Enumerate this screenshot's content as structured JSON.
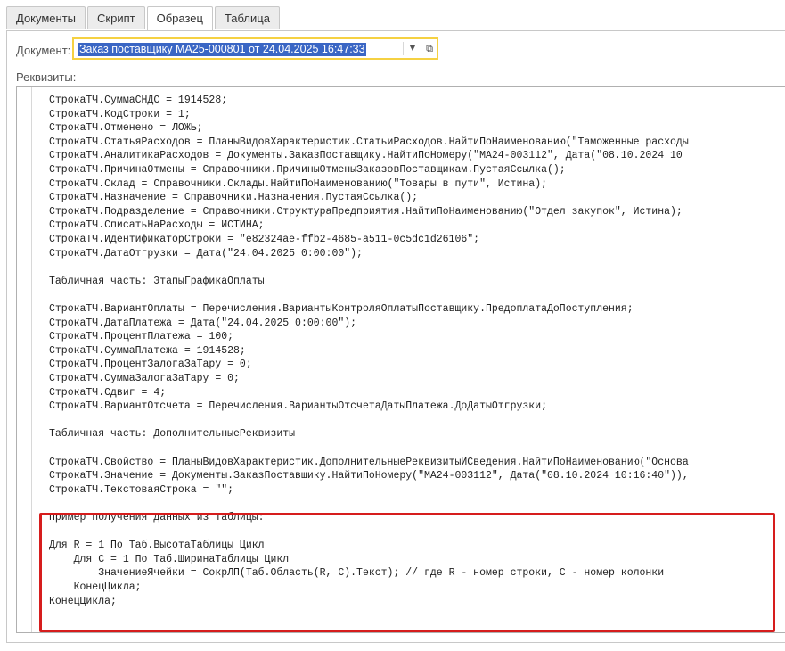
{
  "tabs": [
    {
      "label": "Документы",
      "active": false
    },
    {
      "label": "Скрипт",
      "active": false
    },
    {
      "label": "Образец",
      "active": true
    },
    {
      "label": "Таблица",
      "active": false
    }
  ],
  "document": {
    "label": "Документ:",
    "value": "Заказ поставщику МА25-000801 от 24.04.2025 16:47:33"
  },
  "requisites_label": "Реквизиты:",
  "code_lines": [
    "СтрокаТЧ.СуммаСНДС = 1914528;",
    "СтрокаТЧ.КодСтроки = 1;",
    "СтрокаТЧ.Отменено = ЛОЖЬ;",
    "СтрокаТЧ.СтатьяРасходов = ПланыВидовХарактеристик.СтатьиРасходов.НайтиПоНаименованию(\"Таможенные расходы",
    "СтрокаТЧ.АналитикаРасходов = Документы.ЗаказПоставщику.НайтиПоНомеру(\"МА24-003112\", Дата(\"08.10.2024 10",
    "СтрокаТЧ.ПричинаОтмены = Справочники.ПричиныОтменыЗаказовПоставщикам.ПустаяСсылка();",
    "СтрокаТЧ.Склад = Справочники.Склады.НайтиПоНаименованию(\"Товары в пути\", Истина);",
    "СтрокаТЧ.Назначение = Справочники.Назначения.ПустаяСсылка();",
    "СтрокаТЧ.Подразделение = Справочники.СтруктураПредприятия.НайтиПоНаименованию(\"Отдел закупок\", Истина);",
    "СтрокаТЧ.СписатьНаРасходы = ИСТИНА;",
    "СтрокаТЧ.ИдентификаторСтроки = \"e82324ae-ffb2-4685-a511-0c5dc1d26106\";",
    "СтрокаТЧ.ДатаОтгрузки = Дата(\"24.04.2025 0:00:00\");",
    "",
    "Табличная часть: ЭтапыГрафикаОплаты",
    "",
    "СтрокаТЧ.ВариантОплаты = Перечисления.ВариантыКонтроляОплатыПоставщику.ПредоплатаДоПоступления;",
    "СтрокаТЧ.ДатаПлатежа = Дата(\"24.04.2025 0:00:00\");",
    "СтрокаТЧ.ПроцентПлатежа = 100;",
    "СтрокаТЧ.СуммаПлатежа = 1914528;",
    "СтрокаТЧ.ПроцентЗалогаЗаТару = 0;",
    "СтрокаТЧ.СуммаЗалогаЗаТару = 0;",
    "СтрокаТЧ.Сдвиг = 4;",
    "СтрокаТЧ.ВариантОтсчета = Перечисления.ВариантыОтсчетаДатыПлатежа.ДоДатыОтгрузки;",
    "",
    "Табличная часть: ДополнительныеРеквизиты",
    "",
    "СтрокаТЧ.Свойство = ПланыВидовХарактеристик.ДополнительныеРеквизитыИСведения.НайтиПоНаименованию(\"Основа",
    "СтрокаТЧ.Значение = Документы.ЗаказПоставщику.НайтиПоНомеру(\"МА24-003112\", Дата(\"08.10.2024 10:16:40\")),",
    "СтрокаТЧ.ТекстоваяСтрока = \"\";",
    "",
    "Пример получения данных из Таблицы:",
    "",
    "Для R = 1 По Таб.ВысотаТаблицы Цикл",
    "    Для C = 1 По Таб.ШиринаТаблицы Цикл",
    "        ЗначениеЯчейки = СокрЛП(Таб.Область(R, C).Текст); // где R - номер строки, C - номер колонки",
    "    КонецЦикла;",
    "КонецЦикла;"
  ]
}
